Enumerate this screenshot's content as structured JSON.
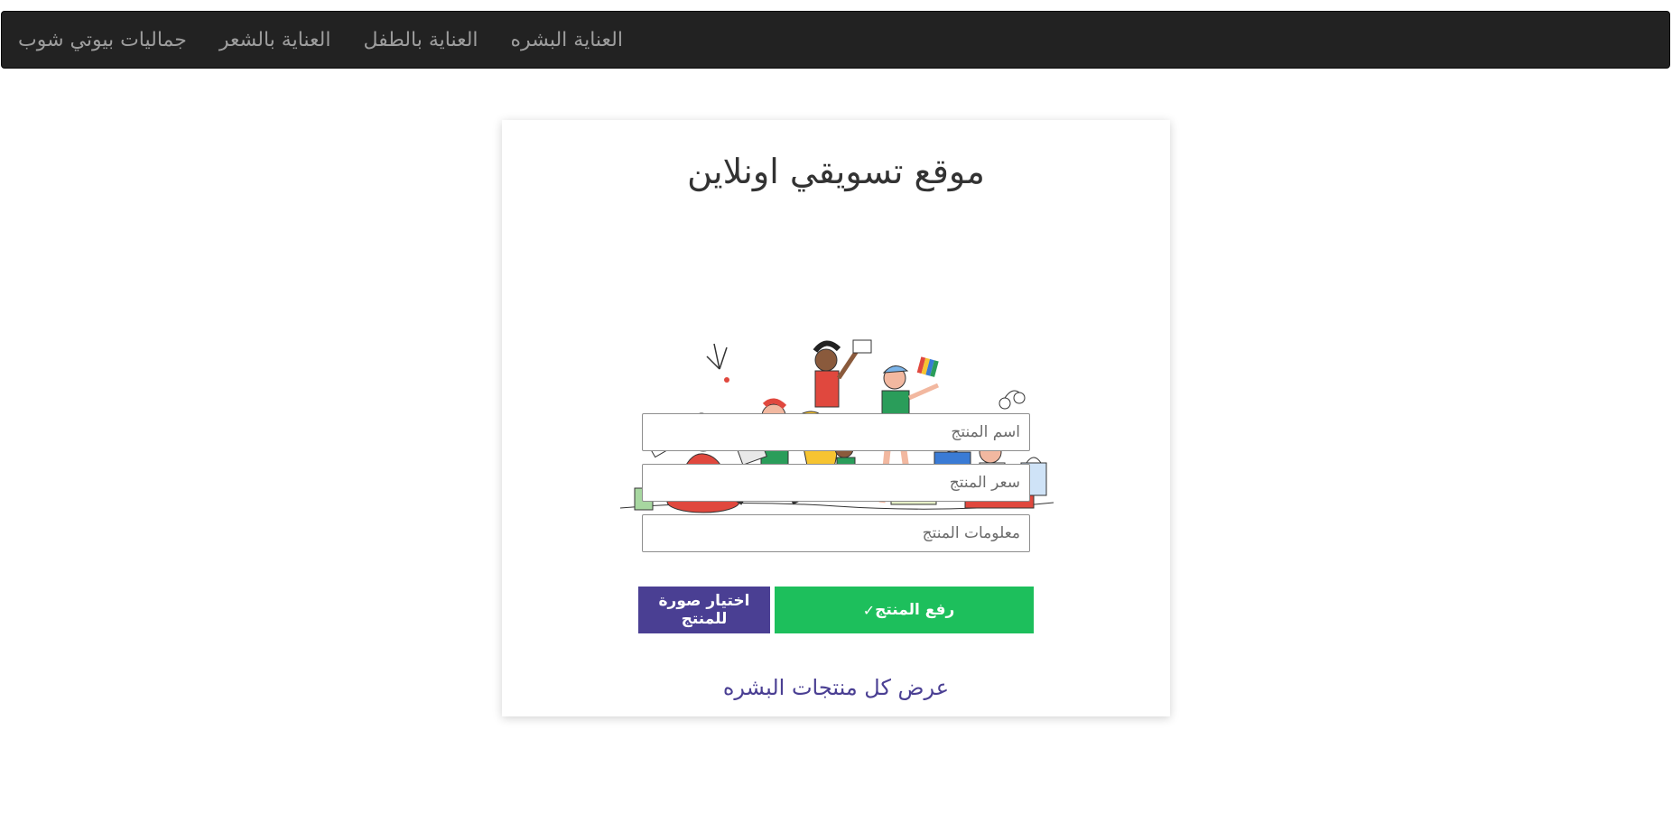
{
  "nav": {
    "items": [
      {
        "label": "جماليات بيوتي شوب"
      },
      {
        "label": "العناية بالشعر"
      },
      {
        "label": "العناية بالطفل"
      },
      {
        "label": "العناية البشره"
      }
    ]
  },
  "card": {
    "title": "موقع تسويقي اونلاين",
    "illustration": "people-shopping-illustration",
    "fields": {
      "name_placeholder": "اسم المنتج",
      "price_placeholder": "سعر المنتج",
      "info_placeholder": "معلومات المنتج"
    },
    "buttons": {
      "choose_image_label": "اختيار صورة للمنتج",
      "upload_label": "رفع المنتج",
      "upload_icon": "check-icon"
    },
    "view_all_link": "عرض كل منتجات البشره"
  },
  "colors": {
    "navbar_bg": "#222222",
    "primary_purple": "#4a3f93",
    "success_green": "#1dbf5c"
  }
}
